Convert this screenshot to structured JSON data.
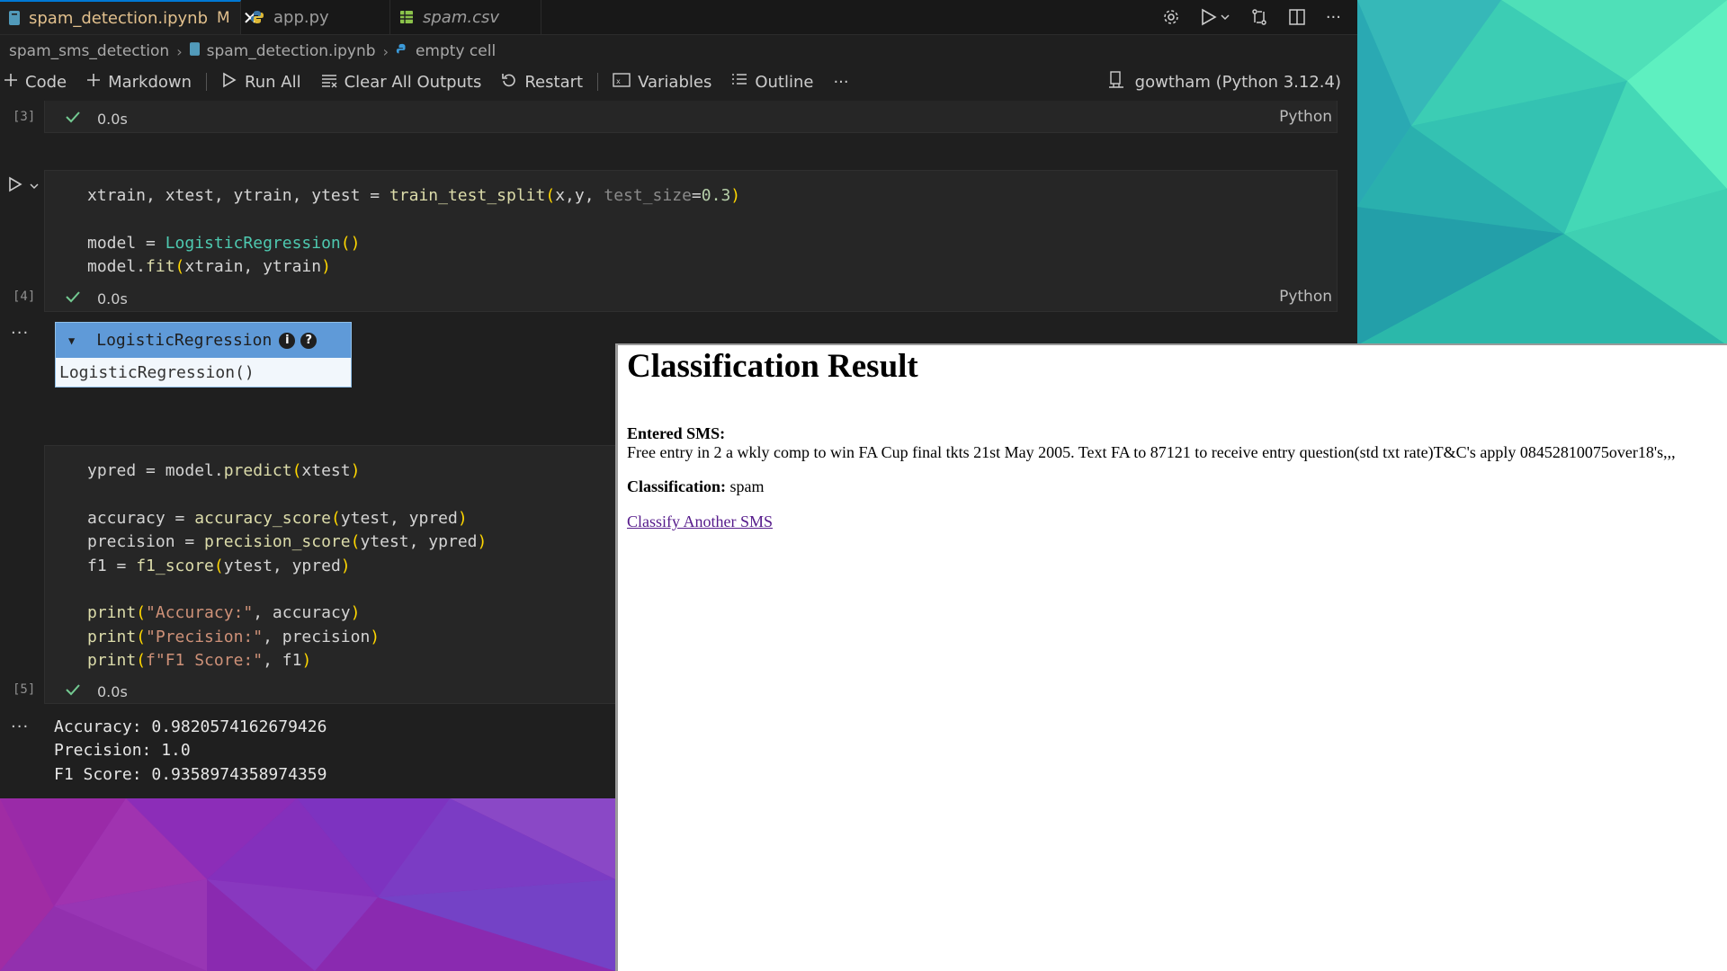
{
  "tabs": [
    {
      "label": "spam_detection.ipynb",
      "modified": "M",
      "icon": "notebook-icon",
      "active": true
    },
    {
      "label": "app.py",
      "icon": "python-icon",
      "active": false
    },
    {
      "label": "spam.csv",
      "icon": "csv-icon",
      "active": false
    }
  ],
  "breadcrumb": {
    "folder": "spam_sms_detection",
    "file": "spam_detection.ipynb",
    "cell": "empty cell"
  },
  "toolbar": {
    "code": "Code",
    "markdown": "Markdown",
    "run_all": "Run All",
    "clear_outputs": "Clear All Outputs",
    "restart": "Restart",
    "variables": "Variables",
    "outline": "Outline",
    "more": "···",
    "kernel": "gowtham (Python 3.12.4)"
  },
  "cells": {
    "c3": {
      "count": "[3]",
      "time": "0.0s",
      "lang": "Python"
    },
    "c4": {
      "count": "[4]",
      "time": "0.0s",
      "lang": "Python"
    },
    "c5": {
      "count": "[5]",
      "time": "0.0s"
    }
  },
  "widget": {
    "title": "LogisticRegression",
    "info": "i",
    "help": "?",
    "repr": "LogisticRegression()"
  },
  "output": {
    "accuracy": "Accuracy: 0.9820574162679426",
    "precision": "Precision: 1.0",
    "f1": "F1 Score: 0.9358974358974359",
    "dots": "···"
  },
  "page": {
    "title": "Classification Result",
    "sms_label": "Entered SMS:",
    "sms_text": "Free entry in 2 a wkly comp to win FA Cup final tkts 21st May 2005. Text FA to 87121 to receive entry question(std txt rate)T&C's apply 08452810075over18's,,,",
    "class_label": "Classification:",
    "class_value": "spam",
    "link": "Classify Another SMS"
  }
}
